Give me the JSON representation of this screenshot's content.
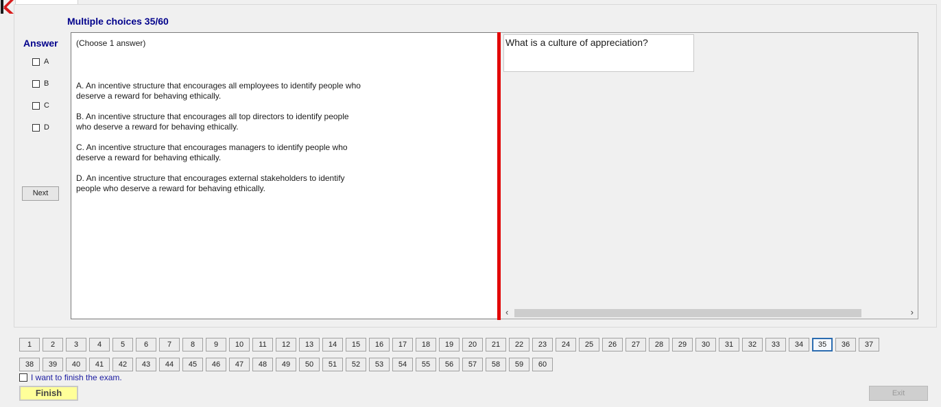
{
  "header": {
    "title": "Multiple choices 35/60"
  },
  "answer_panel": {
    "label": "Answer",
    "options": [
      {
        "letter": "A",
        "checked": false
      },
      {
        "letter": "B",
        "checked": false
      },
      {
        "letter": "C",
        "checked": false
      },
      {
        "letter": "D",
        "checked": false
      }
    ],
    "next_label": "Next"
  },
  "question_panel": {
    "instruction": "(Choose 1 answer)",
    "answers": [
      {
        "line1": "A.  An incentive structure that encourages all employees to identify people who",
        "line2": "deserve a reward for behaving ethically."
      },
      {
        "line1": "B.  An incentive structure that encourages all top directors to identify people",
        "line2": "who deserve a reward for behaving ethically."
      },
      {
        "line1": "C.  An incentive structure that encourages managers to identify people who",
        "line2": "deserve a reward for behaving ethically."
      },
      {
        "line1": "D.  An incentive structure that encourages external stakeholders to identify",
        "line2": "people who deserve a reward for behaving ethically."
      }
    ]
  },
  "question_box": {
    "text": "What is a culture of appreciation?"
  },
  "scrollbar": {
    "left_arrow": "‹",
    "right_arrow": "›"
  },
  "navigation": {
    "row1": [
      "1",
      "2",
      "3",
      "4",
      "5",
      "6",
      "7",
      "8",
      "9",
      "10",
      "11",
      "12",
      "13",
      "14",
      "15",
      "16",
      "17",
      "18",
      "19",
      "20",
      "21",
      "22",
      "23",
      "24",
      "25",
      "26",
      "27",
      "28",
      "29",
      "30",
      "31",
      "32",
      "33",
      "34",
      "35",
      "36",
      "37"
    ],
    "row2": [
      "38",
      "39",
      "40",
      "41",
      "42",
      "43",
      "44",
      "45",
      "46",
      "47",
      "48",
      "49",
      "50",
      "51",
      "52",
      "53",
      "54",
      "55",
      "56",
      "57",
      "58",
      "59",
      "60"
    ],
    "current": "35"
  },
  "footer": {
    "finish_checkbox_label": "I want to finish the exam.",
    "finish_label": "Finish",
    "exit_label": "Exit"
  },
  "colors": {
    "accent": "#00008b",
    "divider": "#e20000",
    "finish_bg": "#ffff99"
  }
}
